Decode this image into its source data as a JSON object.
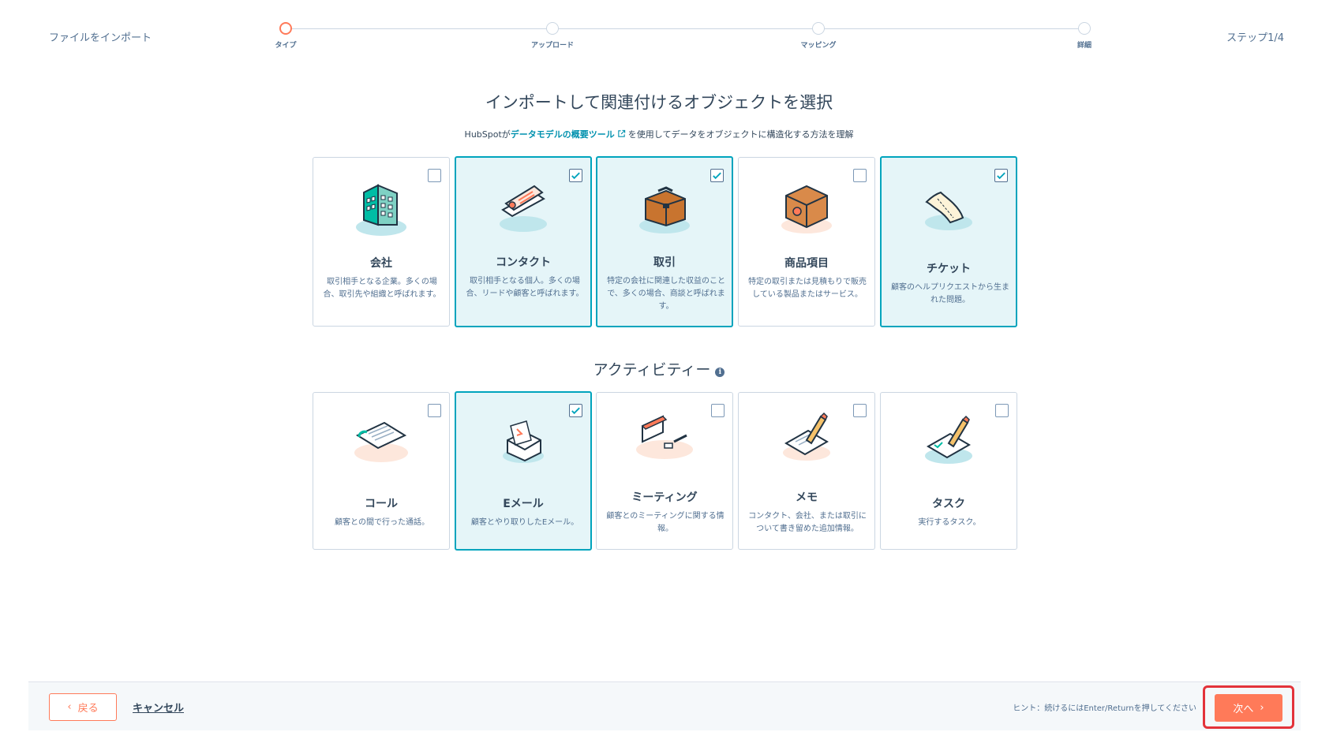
{
  "header": {
    "title": "ファイルをインポート",
    "step_counter": "ステップ1/4",
    "steps": [
      {
        "label": "タイプ"
      },
      {
        "label": "アップロード"
      },
      {
        "label": "マッピング"
      },
      {
        "label": "詳細"
      }
    ]
  },
  "main": {
    "heading": "インポートして関連付けるオブジェクトを選択",
    "sub_prefix": "HubSpotが",
    "sub_link": "データモデルの概要ツール",
    "sub_suffix": "を使用してデータをオブジェクトに構造化する方法を理解",
    "objects": [
      {
        "title": "会社",
        "desc": "取引相手となる企業。多くの場合、取引先や組織と呼ばれます。",
        "selected": false,
        "icon": "building-icon"
      },
      {
        "title": "コンタクト",
        "desc": "取引相手となる個人。多くの場合、リードや顧客と呼ばれます。",
        "selected": true,
        "icon": "contact-card-icon"
      },
      {
        "title": "取引",
        "desc": "特定の会社に関連した収益のことで、多くの場合、商談と呼ばれます。",
        "selected": true,
        "icon": "briefcase-icon"
      },
      {
        "title": "商品項目",
        "desc": "特定の取引または見積もりで販売している製品またはサービス。",
        "selected": false,
        "icon": "package-box-icon"
      },
      {
        "title": "チケット",
        "desc": "顧客のヘルプリクエストから生まれた問題。",
        "selected": true,
        "icon": "ticket-icon"
      }
    ],
    "activities_heading": "アクティビティー",
    "activities": [
      {
        "title": "コール",
        "desc": "顧客との間で行った通話。",
        "selected": false,
        "icon": "phone-call-icon"
      },
      {
        "title": "Eメール",
        "desc": "顧客とやり取りしたEメール。",
        "selected": true,
        "icon": "email-envelope-icon"
      },
      {
        "title": "ミーティング",
        "desc": "顧客とのミーティングに関する情報。",
        "selected": false,
        "icon": "calendar-meeting-icon"
      },
      {
        "title": "メモ",
        "desc": "コンタクト、会社、または取引について書き留めた追加情報。",
        "selected": false,
        "icon": "note-pencil-icon"
      },
      {
        "title": "タスク",
        "desc": "実行するタスク。",
        "selected": false,
        "icon": "task-pencil-icon"
      }
    ]
  },
  "footer": {
    "back_label": "戻る",
    "cancel_label": "キャンセル",
    "hint": "ヒント：続けるにはEnter/Returnを押してください",
    "next_label": "次へ"
  },
  "colors": {
    "accent": "#ff7a59",
    "selected_border": "#00a4bd",
    "selected_bg": "#e5f5f8",
    "link": "#0091ae",
    "highlight": "#e3333a"
  }
}
